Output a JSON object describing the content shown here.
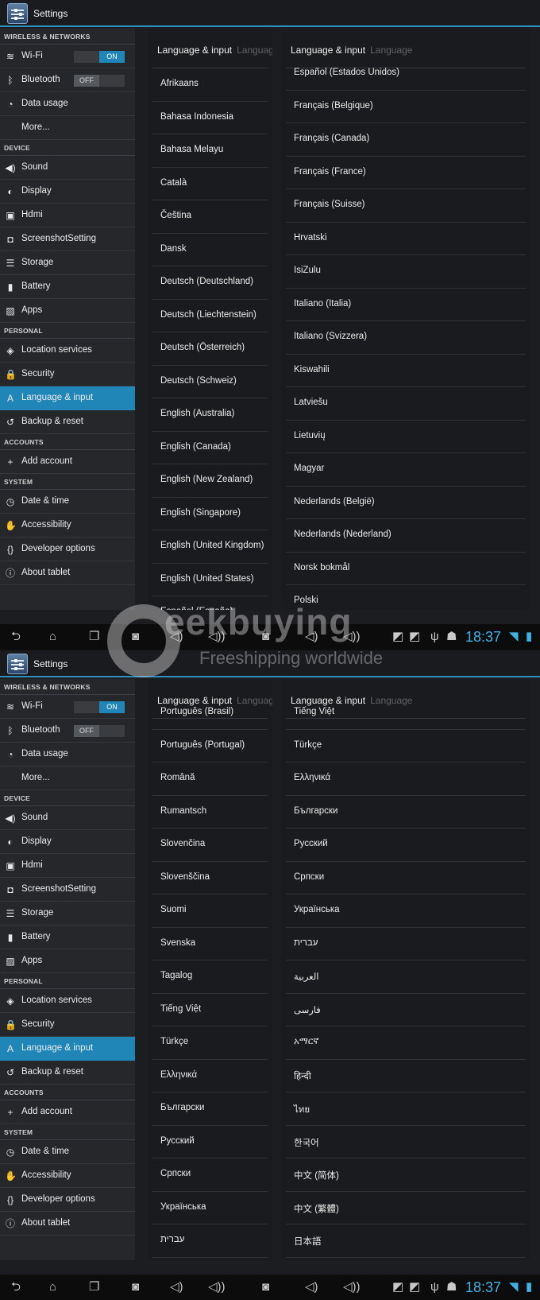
{
  "app_title": "Settings",
  "sidebar": {
    "sections": [
      {
        "header": "WIRELESS & NETWORKS",
        "items": [
          {
            "label": "Wi-Fi",
            "icon": "wifi-icon",
            "glyph": "≋",
            "toggle": "ON"
          },
          {
            "label": "Bluetooth",
            "icon": "bluetooth-icon",
            "glyph": "ᛒ",
            "toggle": "OFF"
          },
          {
            "label": "Data usage",
            "icon": "data-usage-icon",
            "glyph": "◔"
          },
          {
            "label": "More...",
            "icon": "",
            "glyph": ""
          }
        ]
      },
      {
        "header": "DEVICE",
        "items": [
          {
            "label": "Sound",
            "icon": "sound-icon",
            "glyph": "◀)"
          },
          {
            "label": "Display",
            "icon": "display-icon",
            "glyph": "◐"
          },
          {
            "label": "Hdmi",
            "icon": "hdmi-icon",
            "glyph": "▣"
          },
          {
            "label": "ScreenshotSetting",
            "icon": "camera-icon",
            "glyph": "◘"
          },
          {
            "label": "Storage",
            "icon": "storage-icon",
            "glyph": "☰"
          },
          {
            "label": "Battery",
            "icon": "battery-icon",
            "glyph": "▮"
          },
          {
            "label": "Apps",
            "icon": "apps-icon",
            "glyph": "▨"
          }
        ]
      },
      {
        "header": "PERSONAL",
        "items": [
          {
            "label": "Location services",
            "icon": "location-icon",
            "glyph": "◈"
          },
          {
            "label": "Security",
            "icon": "lock-icon",
            "glyph": "🔒"
          },
          {
            "label": "Language & input",
            "icon": "language-icon",
            "glyph": "A",
            "active": true
          },
          {
            "label": "Backup & reset",
            "icon": "backup-icon",
            "glyph": "↺"
          }
        ]
      },
      {
        "header": "ACCOUNTS",
        "items": [
          {
            "label": "Add account",
            "icon": "plus-icon",
            "glyph": "+"
          }
        ]
      },
      {
        "header": "SYSTEM",
        "items": [
          {
            "label": "Date & time",
            "icon": "clock-icon",
            "glyph": "◷"
          },
          {
            "label": "Accessibility",
            "icon": "hand-icon",
            "glyph": "✋"
          },
          {
            "label": "Developer options",
            "icon": "braces-icon",
            "glyph": "{}"
          },
          {
            "label": "About tablet",
            "icon": "info-icon",
            "glyph": "ⓘ"
          }
        ]
      }
    ]
  },
  "panel_title": "Language & input",
  "panel_subtitle": "Language",
  "screens": [
    {
      "left_list": [
        "Afrikaans",
        "Bahasa Indonesia",
        "Bahasa Melayu",
        "Català",
        "Čeština",
        "Dansk",
        "Deutsch (Deutschland)",
        "Deutsch (Liechtenstein)",
        "Deutsch (Österreich)",
        "Deutsch (Schweiz)",
        "English (Australia)",
        "English (Canada)",
        "English (New Zealand)",
        "English (Singapore)",
        "English (United Kingdom)",
        "English (United States)",
        "Español (España)"
      ],
      "right_list": [
        "Español (Estados Unidos)",
        "Français (Belgique)",
        "Français (Canada)",
        "Français (France)",
        "Français (Suisse)",
        "Hrvatski",
        "IsiZulu",
        "Italiano (Italia)",
        "Italiano (Svizzera)",
        "Kiswahili",
        "Latviešu",
        "Lietuvių",
        "Magyar",
        "Nederlands (België)",
        "Nederlands (Nederland)",
        "Norsk bokmål",
        "Polski"
      ]
    },
    {
      "left_list": [
        "Português (Brasil)",
        "Português (Portugal)",
        "Română",
        "Rumantsch",
        "Slovenčina",
        "Slovenščina",
        "Suomi",
        "Svenska",
        "Tagalog",
        "Tiếng Việt",
        "Türkçe",
        "Ελληνικά",
        "Български",
        "Русский",
        "Српски",
        "Українська",
        "עברית"
      ],
      "right_list": [
        "Tiếng Việt",
        "Türkçe",
        "Ελληνικά",
        "Български",
        "Русский",
        "Српски",
        "Українська",
        "עברית",
        "العربية",
        "فارسی",
        "አማርኛ",
        "हिन्दी",
        "ไทย",
        "한국어",
        "中文 (简体)",
        "中文 (繁體)",
        "日本語"
      ]
    }
  ],
  "status": {
    "time": "18:37"
  },
  "watermark": {
    "word": "eekbuying",
    "tagline": "Freeshipping worldwide"
  },
  "colors": {
    "accent": "#1f86b7",
    "clock": "#3fb3e6"
  }
}
